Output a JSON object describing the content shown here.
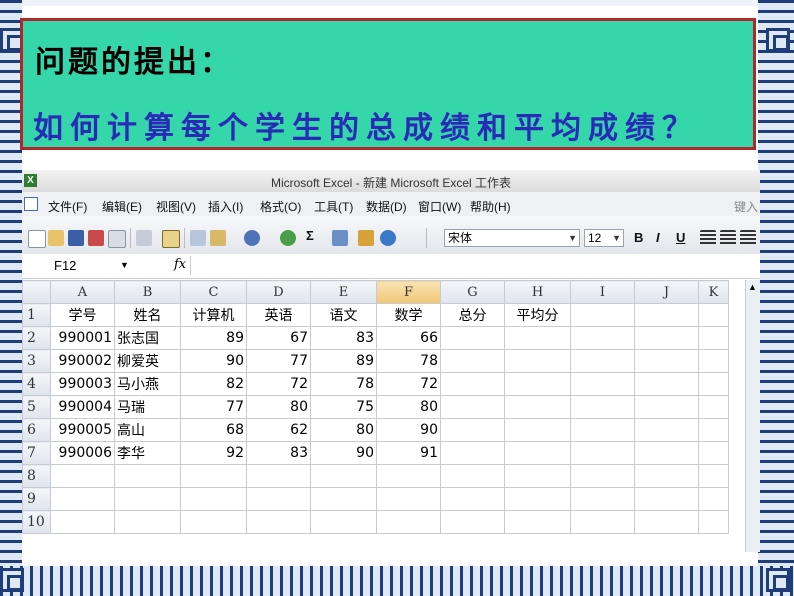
{
  "slide": {
    "heading": "问题的提出：",
    "question": "如何计算每个学生的总成绩和平均成绩？",
    "colors": {
      "box_fill": "#35d6a9",
      "box_border": "#b0282e",
      "question_text": "#2a2ab8",
      "border_pattern": "#1f3d78"
    }
  },
  "window": {
    "title": "Microsoft Excel - 新建 Microsoft Excel 工作表",
    "app_icon": "excel-icon"
  },
  "menu": {
    "items": [
      "文件(F)",
      "编辑(E)",
      "视图(V)",
      "插入(I)",
      "格式(O)",
      "工具(T)",
      "数据(D)",
      "窗口(W)",
      "帮助(H)"
    ],
    "help_hint": "键入"
  },
  "toolbar": {
    "font_name": "宋体",
    "font_size": "12",
    "bold": "B",
    "italic": "I",
    "underline": "U",
    "sum": "Σ"
  },
  "formula_bar": {
    "cell_ref": "F12",
    "fx": "fx",
    "content": ""
  },
  "sheet": {
    "columns": [
      "A",
      "B",
      "C",
      "D",
      "E",
      "F",
      "G",
      "H",
      "I",
      "J",
      "K"
    ],
    "selected_column": "F",
    "row_numbers": [
      "1",
      "2",
      "3",
      "4",
      "5",
      "6",
      "7",
      "8",
      "9",
      "10"
    ],
    "header_row": [
      "学号",
      "姓名",
      "计算机",
      "英语",
      "语文",
      "数学",
      "总分",
      "平均分",
      "",
      "",
      ""
    ],
    "rows": [
      [
        "990001",
        "张志国",
        "89",
        "67",
        "83",
        "66",
        "",
        "",
        "",
        "",
        ""
      ],
      [
        "990002",
        "柳爱英",
        "90",
        "77",
        "89",
        "78",
        "",
        "",
        "",
        "",
        ""
      ],
      [
        "990003",
        "马小燕",
        "82",
        "72",
        "78",
        "72",
        "",
        "",
        "",
        "",
        ""
      ],
      [
        "990004",
        "马瑞",
        "77",
        "80",
        "75",
        "80",
        "",
        "",
        "",
        "",
        ""
      ],
      [
        "990005",
        "高山",
        "68",
        "62",
        "80",
        "90",
        "",
        "",
        "",
        "",
        ""
      ],
      [
        "990006",
        "李华",
        "92",
        "83",
        "90",
        "91",
        "",
        "",
        "",
        "",
        ""
      ],
      [
        "",
        "",
        "",
        "",
        "",
        "",
        "",
        "",
        "",
        "",
        ""
      ],
      [
        "",
        "",
        "",
        "",
        "",
        "",
        "",
        "",
        "",
        "",
        ""
      ],
      [
        "",
        "",
        "",
        "",
        "",
        "",
        "",
        "",
        "",
        "",
        ""
      ]
    ]
  }
}
